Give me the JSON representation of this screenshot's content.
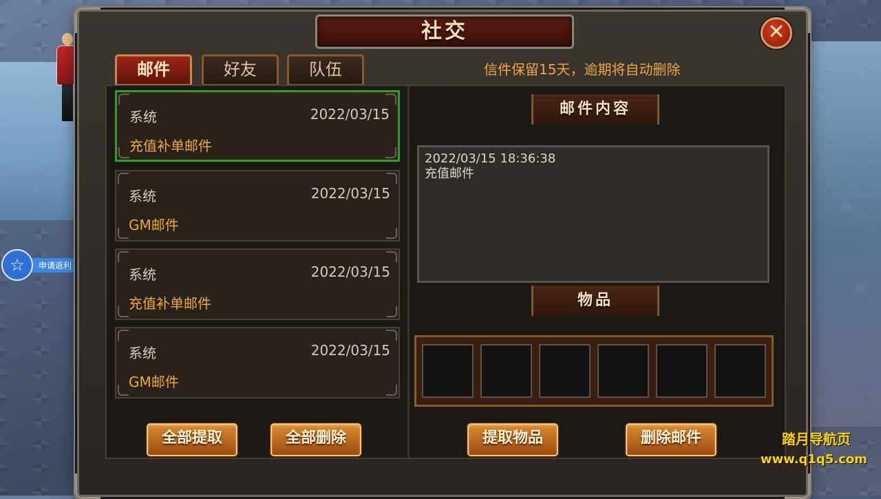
{
  "window": {
    "title": "社交",
    "close_symbol": "✕"
  },
  "tabs": [
    {
      "label": "邮件",
      "active": true
    },
    {
      "label": "好友",
      "active": false
    },
    {
      "label": "队伍",
      "active": false
    }
  ],
  "notice": "信件保留15天，逾期将自动删除",
  "mails": [
    {
      "sender": "系统",
      "date": "2022/03/15",
      "subject": "充值补单邮件",
      "selected": true
    },
    {
      "sender": "系统",
      "date": "2022/03/15",
      "subject": "GM邮件",
      "selected": false
    },
    {
      "sender": "系统",
      "date": "2022/03/15",
      "subject": "充值补单邮件",
      "selected": false
    },
    {
      "sender": "系统",
      "date": "2022/03/15",
      "subject": "GM邮件",
      "selected": false
    }
  ],
  "detail": {
    "content_title": "邮件内容",
    "timestamp": "2022/03/15 18:36:38",
    "body": "充值邮件",
    "items_title": "物品",
    "item_slot_count": 6
  },
  "buttons": {
    "claim_all": "全部提取",
    "delete_all": "全部删除",
    "claim_items": "提取物品",
    "delete_mail": "删除邮件"
  },
  "side": {
    "rebate_label": "申请返利",
    "rebate_icon": "star-icon"
  },
  "watermark": {
    "line1": "踏月导航页",
    "line2": "www.q1q5.com"
  },
  "colors": {
    "accent": "#f0a83c",
    "selected_border": "#2f9f2a",
    "title_red": "#5a1c12"
  }
}
